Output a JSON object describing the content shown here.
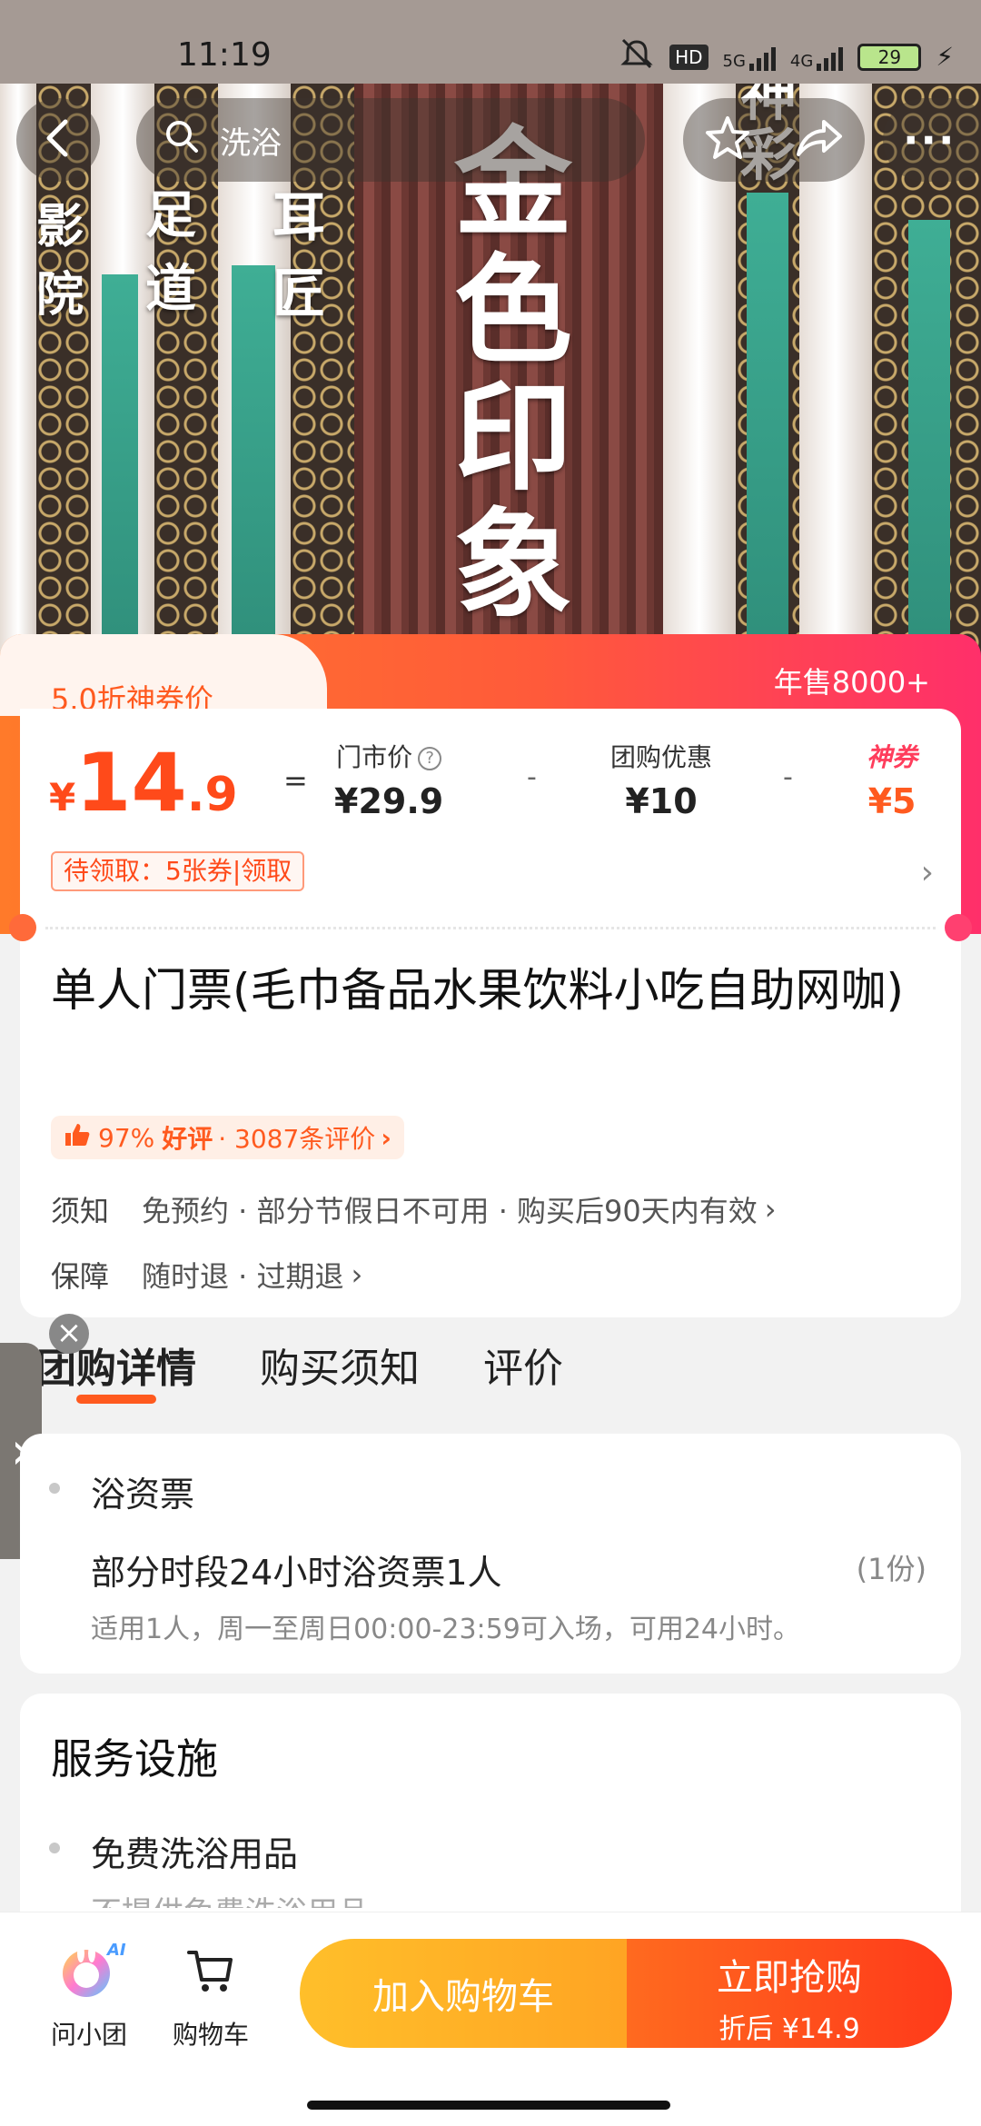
{
  "status_bar": {
    "time": "11:19",
    "network_5g": "5G",
    "network_4g": "4G",
    "hd_badge": "HD",
    "battery": "29"
  },
  "nav": {
    "search_text": "洗浴",
    "more_label": "···"
  },
  "hero_signs": {
    "main_sign": [
      "金",
      "色",
      "印",
      "象"
    ],
    "left_sign_1": [
      "影",
      "院"
    ],
    "left_sign_2": [
      "足",
      "道"
    ],
    "left_sign_3": [
      "耳",
      "匠"
    ],
    "right_sign": [
      "神",
      "彩"
    ]
  },
  "price": {
    "discount_label": "5.0折神券价",
    "annual_sales": "年售8000+",
    "currency": "¥",
    "integer": "14",
    "decimal": ".9",
    "equals": "=",
    "minus": "-",
    "market_price_label": "门市价",
    "market_price_value": "¥29.9",
    "group_discount_label": "团购优惠",
    "group_discount_value": "¥10",
    "shen_label": "神券",
    "shen_value": "¥5",
    "coupon_tag": "待领取：5张券|领取"
  },
  "product": {
    "title": "单人门票(毛巾备品水果饮料小吃自助网咖)",
    "rating_pct": "97%",
    "rating_good": "好评",
    "rating_count": "· 3087条评价",
    "notice_key": "须知",
    "notice_val": "免预约 · 部分节假日不可用 · 购买后90天内有效",
    "guarantee_key": "保障",
    "guarantee_val": "随时退 · 过期退"
  },
  "tabs": [
    "团购详情",
    "购买须知",
    "评价"
  ],
  "detail": {
    "section_label": "浴资票",
    "item_name": "部分时段24小时浴资票1人",
    "item_qty": "(1份)",
    "item_desc": "适用1人，周一至周日00:00-23:59可入场，可用24小时。"
  },
  "services": {
    "heading": "服务设施",
    "item_name": "免费洗浴用品",
    "item_desc": "不提供免费洗浴用品"
  },
  "bottom": {
    "ask_label": "问小团",
    "ask_badge": "AI",
    "cart_label": "购物车",
    "add_cart": "加入购物车",
    "buy_now": "立即抢购",
    "buy_after": "折后 ¥14.9"
  },
  "colors": {
    "accent": "#ff5a1f",
    "pink": "#ff2f6a",
    "yellow": "#ffb323"
  }
}
